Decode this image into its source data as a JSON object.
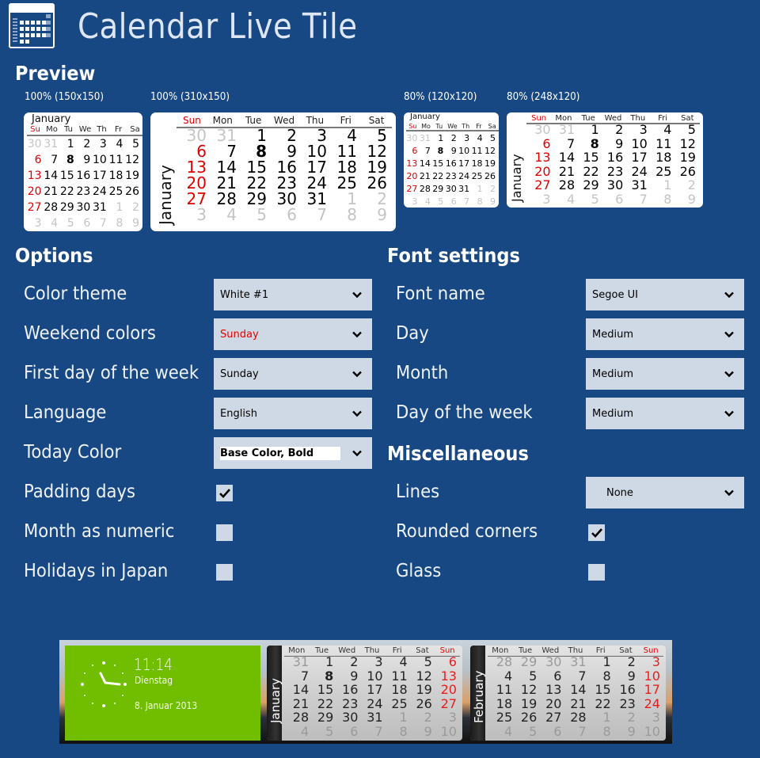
{
  "app": {
    "title": "Calendar Live Tile",
    "icon": "calendar-icon"
  },
  "preview": {
    "title": "Preview",
    "tiles": [
      {
        "label": "100% (150x150)",
        "month": "January",
        "weekdays": [
          "Su",
          "Mo",
          "Tu",
          "We",
          "Th",
          "Fr",
          "Sa"
        ]
      },
      {
        "label": "100% (310x150)",
        "month": "January",
        "weekdays": [
          "Sun",
          "Mon",
          "Tue",
          "Wed",
          "Thu",
          "Fri",
          "Sat"
        ]
      },
      {
        "label": "80% (120x120)",
        "month": "January",
        "weekdays": [
          "Su",
          "Mo",
          "Tu",
          "We",
          "Th",
          "Fr",
          "Sa"
        ]
      },
      {
        "label": "80% (248x120)",
        "month": "January",
        "weekdays": [
          "Sun",
          "Mon",
          "Tue",
          "Wed",
          "Thu",
          "Fri",
          "Sat"
        ]
      }
    ],
    "days": [
      "30",
      "31",
      "1",
      "2",
      "3",
      "4",
      "5",
      "6",
      "7",
      "8",
      "9",
      "10",
      "11",
      "12",
      "13",
      "14",
      "15",
      "16",
      "17",
      "18",
      "19",
      "20",
      "21",
      "22",
      "23",
      "24",
      "25",
      "26",
      "27",
      "28",
      "29",
      "30",
      "31",
      "1",
      "2",
      "3",
      "4",
      "5",
      "6",
      "7",
      "8",
      "9"
    ],
    "padding_before": 2,
    "padding_after": 9,
    "today": "8",
    "weekend_color": "#e00000"
  },
  "options": {
    "title": "Options",
    "color_theme": {
      "label": "Color theme",
      "value": "White #1"
    },
    "weekend_colors": {
      "label": "Weekend colors",
      "value": "Sunday"
    },
    "first_day": {
      "label": "First day of the week",
      "value": "Sunday"
    },
    "language": {
      "label": "Language",
      "value": "English"
    },
    "today_color": {
      "label": "Today Color",
      "value": "Base Color, Bold"
    },
    "padding_days": {
      "label": "Padding days",
      "checked": true
    },
    "month_numeric": {
      "label": "Month as numeric",
      "checked": false
    },
    "holidays_japan": {
      "label": "Holidays in Japan",
      "checked": false
    }
  },
  "font_settings": {
    "title": "Font settings",
    "font_name": {
      "label": "Font name",
      "value": "Segoe UI"
    },
    "day": {
      "label": "Day",
      "value": "Medium"
    },
    "month": {
      "label": "Month",
      "value": "Medium"
    },
    "day_of_week": {
      "label": "Day of the week",
      "value": "Medium"
    }
  },
  "misc": {
    "title": "Miscellaneous",
    "lines": {
      "label": "Lines",
      "value": "None"
    },
    "rounded_corners": {
      "label": "Rounded corners",
      "checked": true
    },
    "glass": {
      "label": "Glass",
      "checked": false
    }
  },
  "sample": {
    "clock": {
      "time": "11:14",
      "day": "Dienstag",
      "date": "8. Januar 2013"
    },
    "weekdays": [
      "Mon",
      "Tue",
      "Wed",
      "Thu",
      "Fri",
      "Sat",
      "Sun"
    ],
    "january": {
      "month": "January",
      "days": [
        "31",
        "1",
        "2",
        "3",
        "4",
        "5",
        "6",
        "7",
        "8",
        "9",
        "10",
        "11",
        "12",
        "13",
        "14",
        "15",
        "16",
        "17",
        "18",
        "19",
        "20",
        "21",
        "22",
        "23",
        "24",
        "25",
        "26",
        "27",
        "28",
        "29",
        "30",
        "31",
        "1",
        "2",
        "3",
        "4",
        "5",
        "6",
        "7",
        "8",
        "9",
        "10"
      ],
      "padding_before": 1,
      "padding_after": 10,
      "today": "8"
    },
    "february": {
      "month": "February",
      "days": [
        "28",
        "29",
        "30",
        "31",
        "1",
        "2",
        "3",
        "4",
        "5",
        "6",
        "7",
        "8",
        "9",
        "10",
        "11",
        "12",
        "13",
        "14",
        "15",
        "16",
        "17",
        "18",
        "19",
        "20",
        "21",
        "22",
        "23",
        "24",
        "25",
        "26",
        "27",
        "28",
        "1",
        "2",
        "3",
        "4",
        "5",
        "6",
        "7",
        "8",
        "9",
        "10"
      ],
      "padding_before": 4,
      "padding_after": 10,
      "today": null
    }
  }
}
